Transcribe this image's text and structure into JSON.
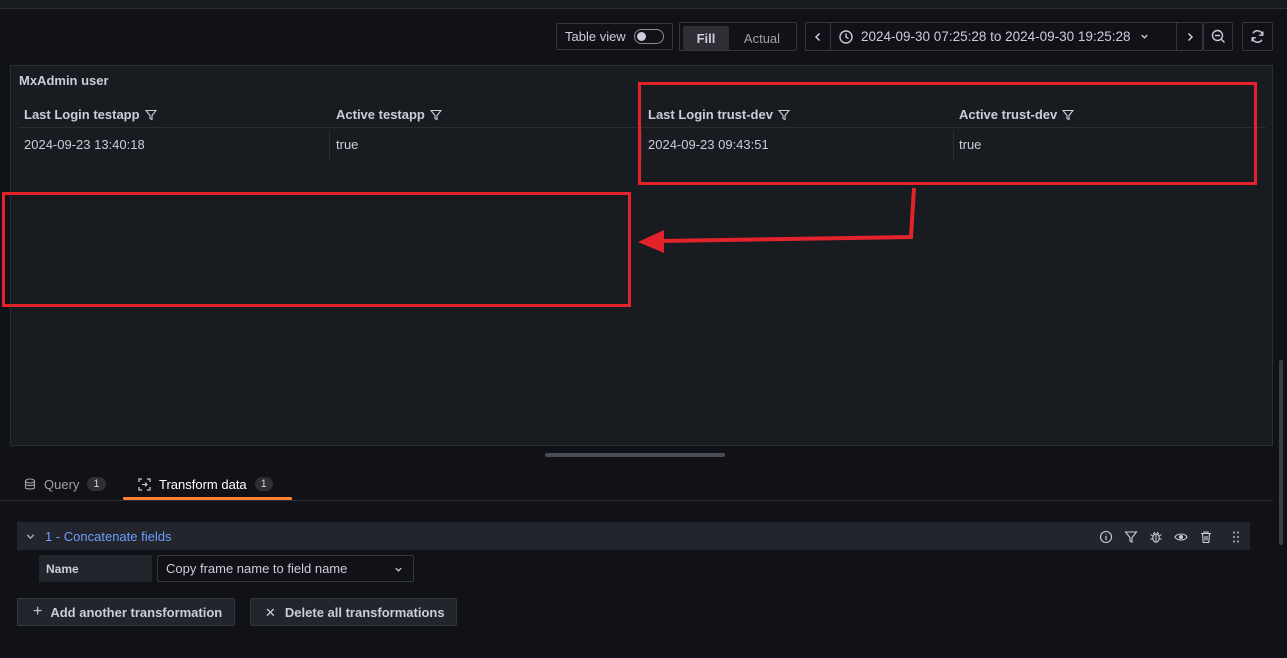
{
  "toolbar": {
    "table_view_label": "Table view",
    "fill_label": "Fill",
    "actual_label": "Actual",
    "time_range": "2024-09-30 07:25:28 to 2024-09-30 19:25:28"
  },
  "panel": {
    "title": "MxAdmin user",
    "columns": [
      "Last Login testapp",
      "Active testapp",
      "Last Login trust-dev",
      "Active trust-dev"
    ],
    "rows": [
      [
        "2024-09-23 13:40:18",
        "true",
        "2024-09-23 09:43:51",
        "true"
      ]
    ]
  },
  "tabs": [
    {
      "label": "Query",
      "count": "1"
    },
    {
      "label": "Transform data",
      "count": "1"
    }
  ],
  "transformation": {
    "title": "1 - Concatenate fields",
    "name_label": "Name",
    "mode_value": "Copy frame name to field name"
  },
  "buttons": {
    "add": "Add another transformation",
    "delete": "Delete all transformations"
  },
  "colors": {
    "accent": "#ff7f30",
    "link": "#6e9fff",
    "annotation": "#e3232b"
  }
}
